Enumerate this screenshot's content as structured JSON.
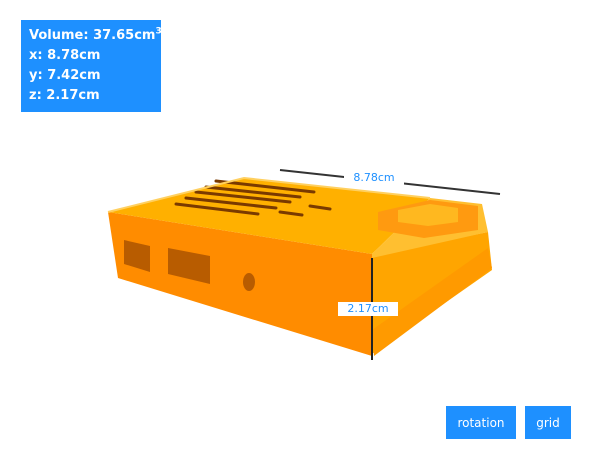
{
  "info": {
    "volume_prefix": "Volume: ",
    "volume_value": "37.65cm",
    "volume_exp": "3",
    "x": "x: 8.78cm",
    "y": "y: 7.42cm",
    "z": "z: 2.17cm"
  },
  "dimensions": {
    "x_label": "8.78cm",
    "z_label": "2.17cm"
  },
  "buttons": {
    "rotation": "rotation",
    "grid": "grid"
  },
  "colors": {
    "accent": "#1e90ff",
    "model_top": "#ffb000",
    "model_side": "#ff8c00"
  }
}
